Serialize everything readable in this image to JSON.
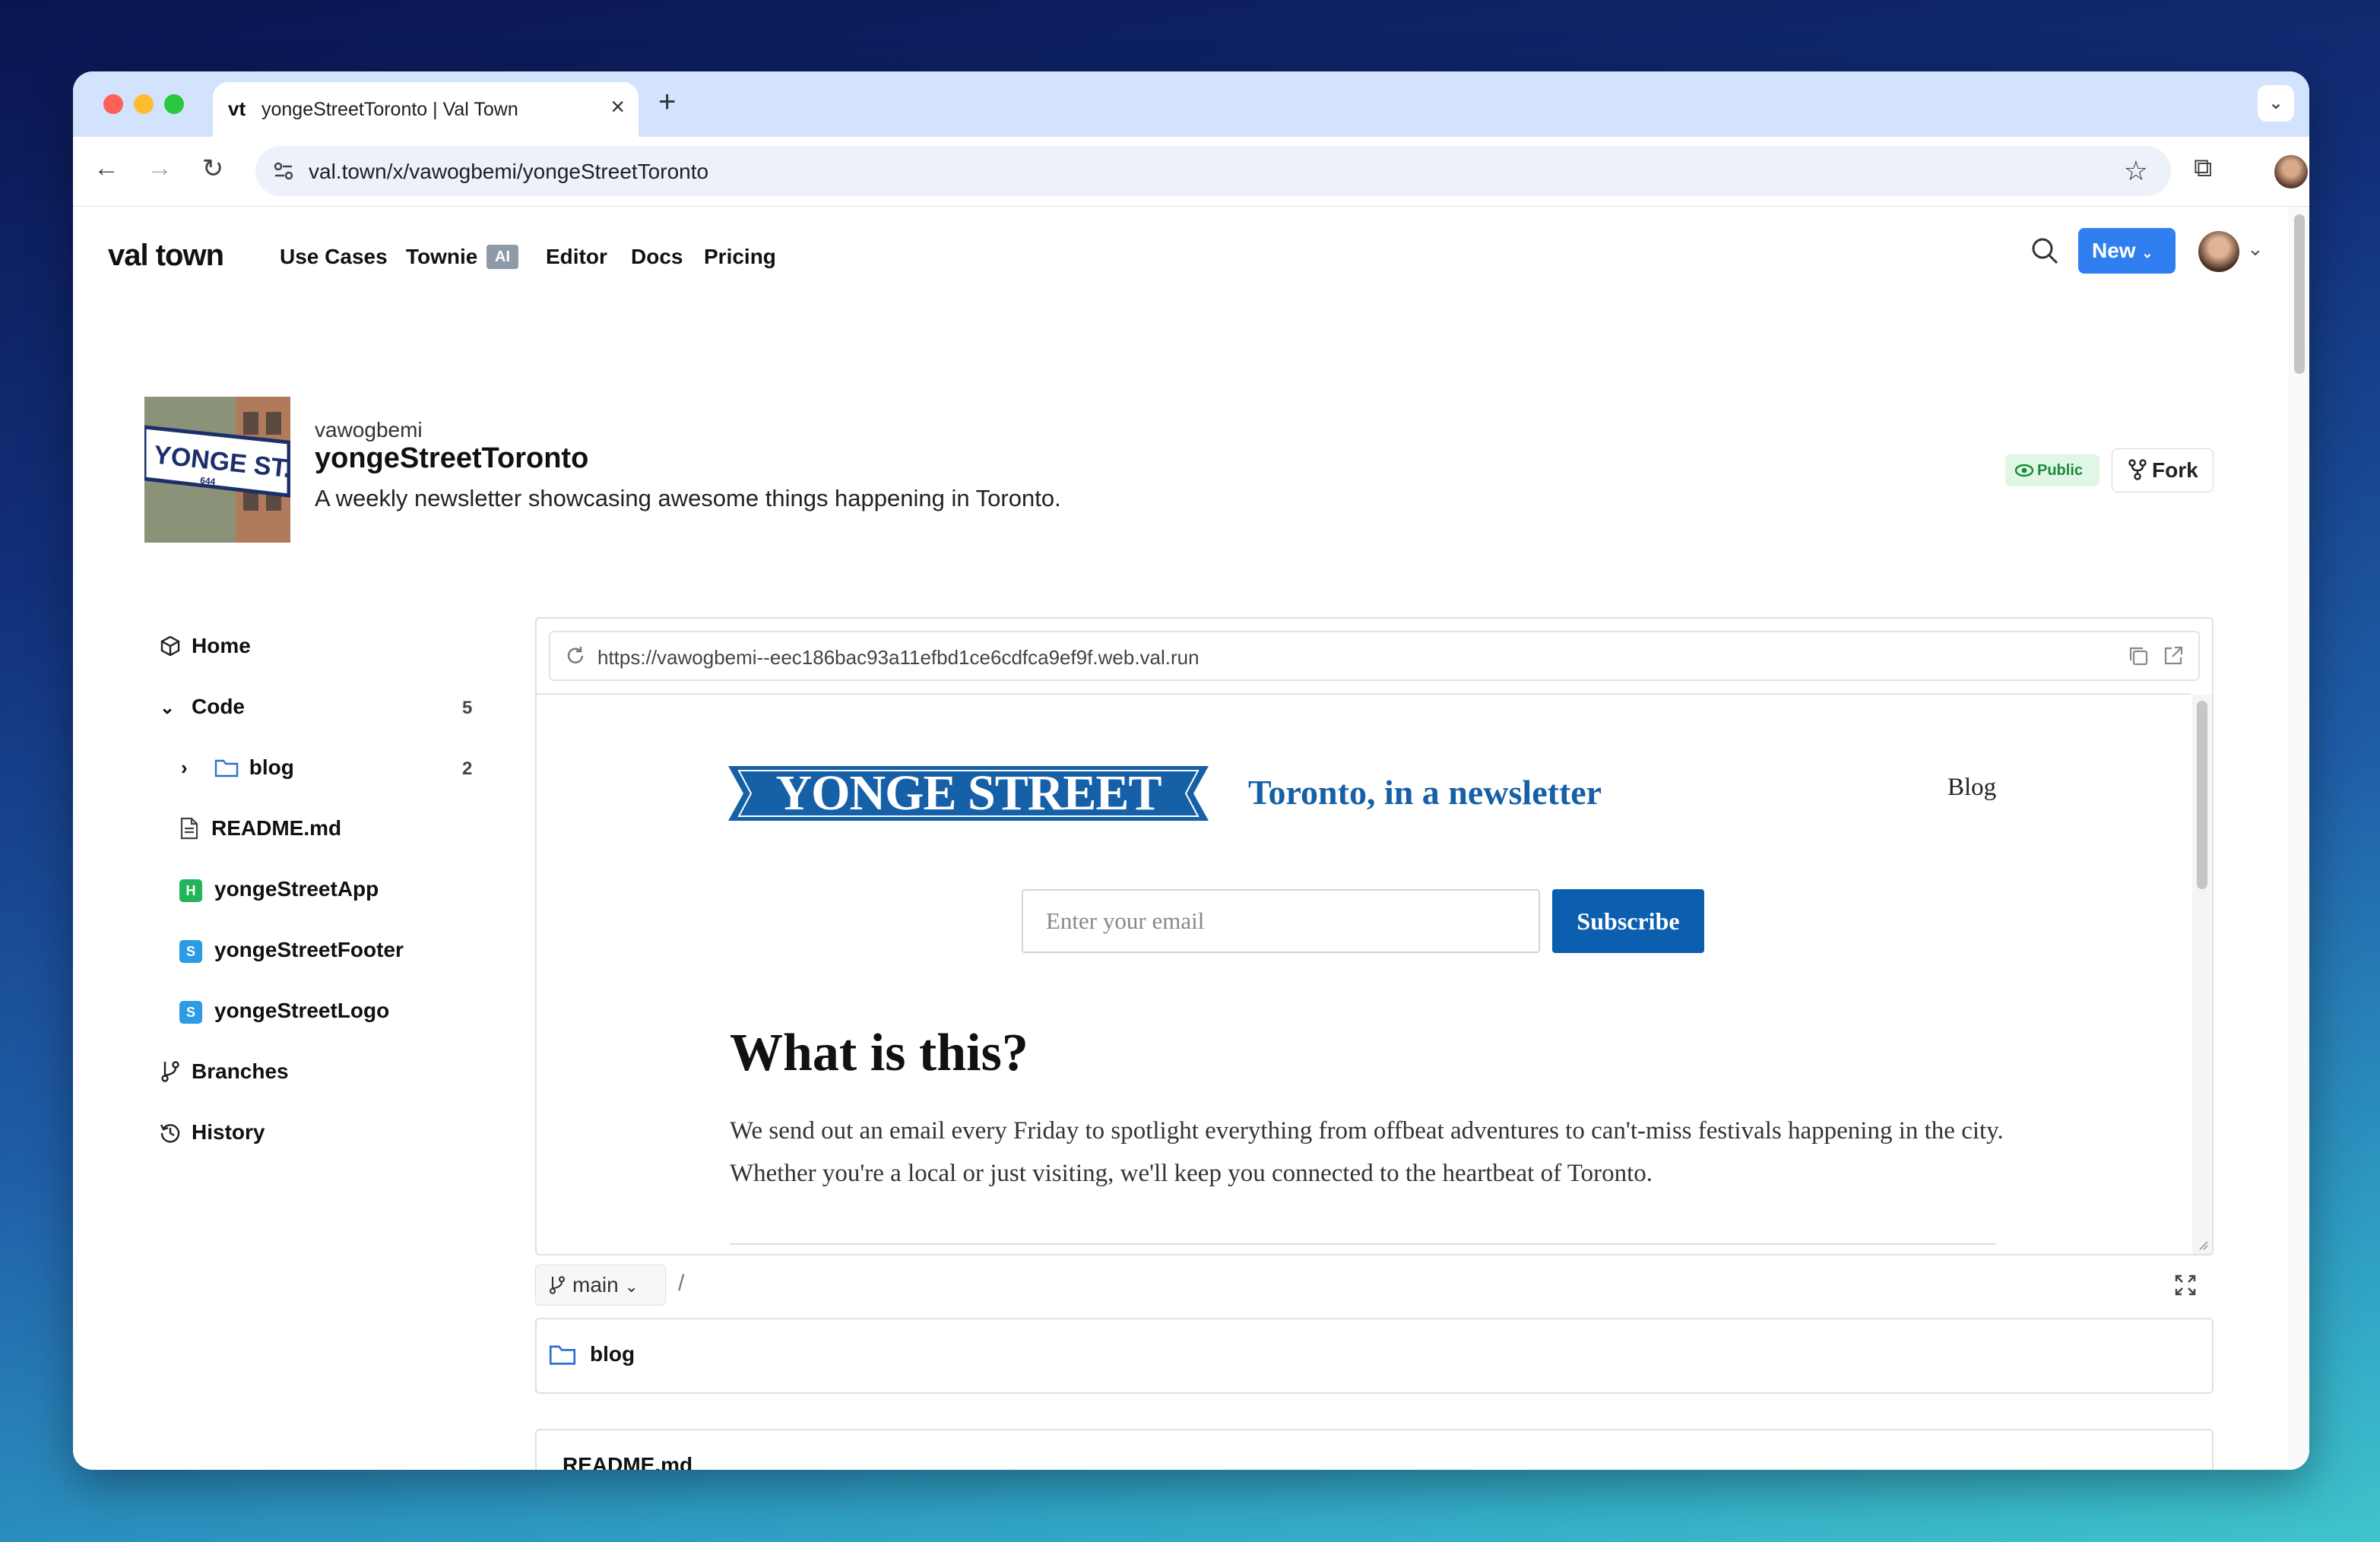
{
  "browser": {
    "tab_title": "yongeStreetToronto | Val Town",
    "tab_favicon": "vt",
    "address": "val.town/x/vawogbemi/yongeStreetToronto"
  },
  "site": {
    "brand": "val town",
    "nav": [
      "Use Cases",
      "Townie",
      "Editor",
      "Docs",
      "Pricing"
    ],
    "ai_badge": "AI",
    "new_button": "New"
  },
  "val": {
    "owner": "vawogbemi",
    "name": "yongeStreetToronto",
    "description": "A weekly newsletter showcasing awesome things happening in Toronto.",
    "visibility": "Public",
    "fork_label": "Fork",
    "thumbnail_sign": "YONGE ST.",
    "thumbnail_sign_number": "644"
  },
  "sidebar": {
    "home": "Home",
    "code": "Code",
    "code_count": "5",
    "folder": "blog",
    "folder_count": "2",
    "files": [
      {
        "label": "README.md",
        "type": ""
      },
      {
        "label": "yongeStreetApp",
        "type": "H",
        "color": "#22b45a"
      },
      {
        "label": "yongeStreetFooter",
        "type": "S",
        "color": "#2d9be4"
      },
      {
        "label": "yongeStreetLogo",
        "type": "S",
        "color": "#2d9be4"
      }
    ],
    "branches": "Branches",
    "history": "History"
  },
  "preview": {
    "url": "https://vawogbemi--eec186bac93a11efbd1ce6cdfca9ef9f.web.val.run",
    "logo_text": "YONGE STREET",
    "tagline": "Toronto, in a newsletter",
    "nav_blog": "Blog",
    "email_placeholder": "Enter your email",
    "subscribe": "Subscribe",
    "heading": "What is this?",
    "body": "We send out an email every Friday to spotlight everything from offbeat adventures to can't-miss festivals happening in the city. Whether you're a local or just visiting, we'll keep you connected to the heartbeat of Toronto."
  },
  "repo": {
    "branch": "main",
    "path_sep": "/",
    "folder": "blog",
    "readme_title": "README.md"
  },
  "colors": {
    "accent": "#2f7ff0",
    "ys_blue": "#0b5fae",
    "public_green": "#1a8a3c"
  }
}
